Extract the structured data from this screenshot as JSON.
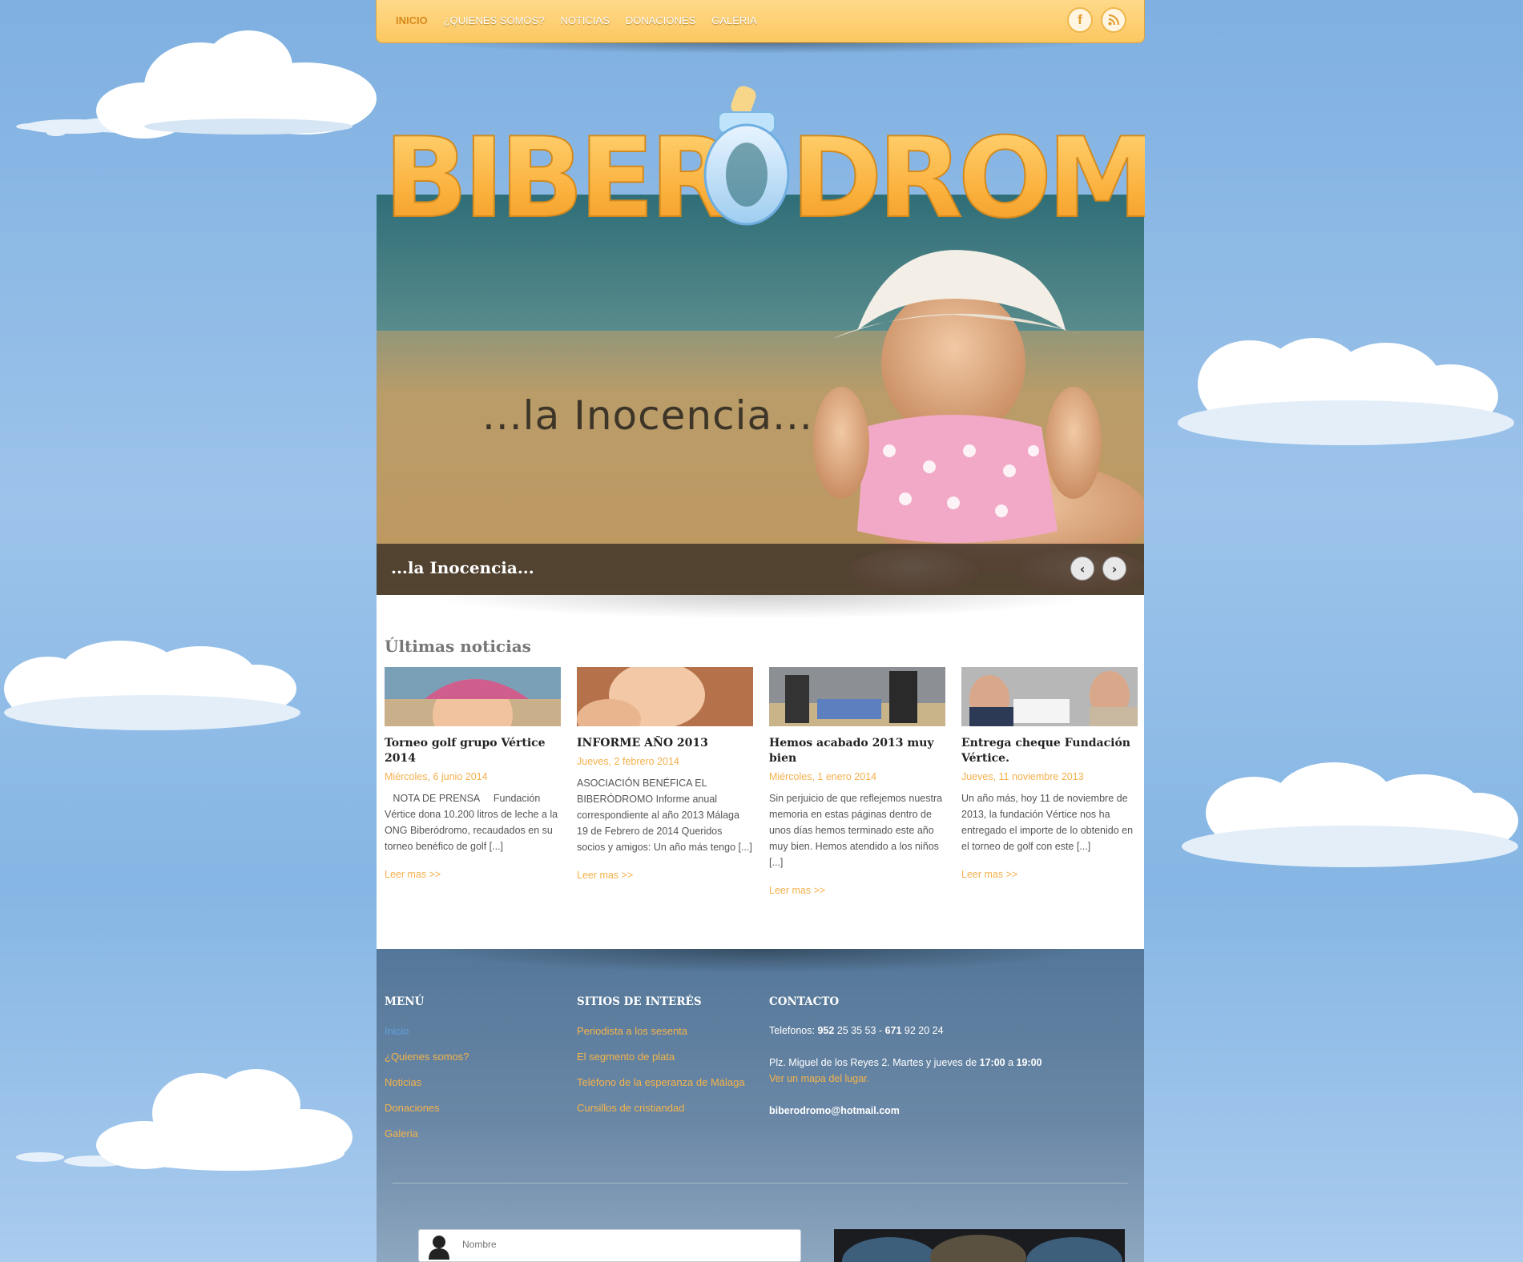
{
  "nav": {
    "items": [
      {
        "label": "INICIO",
        "active": true
      },
      {
        "label": "¿QUIENES SOMOS?",
        "active": false
      },
      {
        "label": "NOTICIAS",
        "active": false
      },
      {
        "label": "DONACIONES",
        "active": false
      },
      {
        "label": "GALERIA",
        "active": false
      }
    ],
    "social": [
      {
        "icon": "facebook-icon",
        "glyph": "f"
      },
      {
        "icon": "rss-icon",
        "glyph": "⊃"
      }
    ]
  },
  "logo": {
    "text_left": "BIBER",
    "text_right": "DROMO"
  },
  "hero": {
    "caption_big": "...la Inocencia...",
    "caption_bar": "...la Inocencia...",
    "prev_icon": "‹",
    "next_icon": "›"
  },
  "news_section": {
    "title": "Últimas noticias",
    "items": [
      {
        "title": "Torneo golf grupo Vértice 2014",
        "date": "Miércoles, 6 junio 2014",
        "excerpt": "   NOTA DE PRENSA     Fundación Vértice dona 10.200 litros de leche a la ONG Biberódromo, recaudados en su torneo benéfico de golf [...]",
        "more": "Leer mas >>"
      },
      {
        "title": "INFORME AÑO 2013",
        "date": "Jueves, 2 febrero 2014",
        "excerpt": "ASOCIACIÓN BENÉFICA EL BIBERÓDROMO Informe anual correspondiente al año 2013 Málaga 19 de Febrero de 2014 Queridos socios y amigos: Un año más tengo [...]",
        "more": "Leer mas >>"
      },
      {
        "title": "Hemos acabado 2013 muy bien",
        "date": "Miércoles, 1 enero 2014",
        "excerpt": "Sin perjuicio de que reflejemos nuestra memoria en estas páginas dentro de unos días hemos terminado este año muy bien. Hemos atendido a los niños [...]",
        "more": "Leer mas >>"
      },
      {
        "title": "Entrega cheque Fundación Vértice.",
        "date": "Jueves, 11 noviembre 2013",
        "excerpt": "Un año más, hoy 11 de noviembre de 2013, la fundación Vértice nos ha entregado el importe de lo obtenido en el torneo de golf con este [...]",
        "more": "Leer mas >>"
      }
    ]
  },
  "footer": {
    "menu_title": "MENÚ",
    "menu": [
      "Inicio",
      "¿Quienes somos?",
      "Noticias",
      "Donaciones",
      "Galeria"
    ],
    "sites_title": "SITIOS DE INTERÉS",
    "sites": [
      "Periodista a los sesenta",
      "El segmento de plata",
      "Teléfono de la esperanza de Málaga",
      "Cursillos de cristiandad"
    ],
    "contact_title": "CONTACTO",
    "phones_label": "Telefonos: ",
    "phone1": "952",
    "phone1_rest": " 25 35 53 - ",
    "phone2": "671",
    "phone2_rest": " 92 20 24",
    "address": "Plz. Miguel de los Reyes 2. Martes y jueves de ",
    "time_from": "17:00",
    "time_sep": " a ",
    "time_to": "19:00",
    "map_link": "Ver un mapa del lugar.",
    "email": "biberodromo@hotmail.com",
    "name_placeholder": "Nombre"
  },
  "colors": {
    "accent": "#f4b04c",
    "nav_bg": "#fbc861",
    "footer_bg": "#547799",
    "link_current": "#5da0df"
  }
}
